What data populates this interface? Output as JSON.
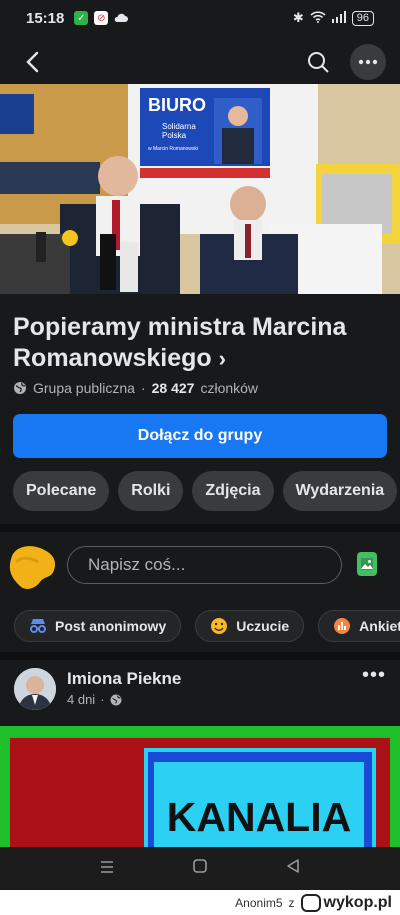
{
  "status_bar": {
    "time": "15:18",
    "battery": "96"
  },
  "nav": {},
  "cover": {
    "sign_title": "BIURO",
    "sign_sub1": "Solidarna",
    "sign_sub2": "Polska",
    "sign_sub3": "w Marcin Romanowski"
  },
  "group": {
    "title": "Popieramy ministra Marcina Romanowskiego",
    "chevron": "›",
    "privacy": "Grupa publiczna",
    "separator": "·",
    "members_count": "28 427",
    "members_label": "członków",
    "join_label": "Dołącz do grupy"
  },
  "tabs": [
    {
      "label": "Polecane"
    },
    {
      "label": "Rolki"
    },
    {
      "label": "Zdjęcia"
    },
    {
      "label": "Wydarzenia"
    }
  ],
  "composer": {
    "placeholder": "Napisz coś..."
  },
  "chips": [
    {
      "label": "Post anonimowy",
      "icon": "incognito-icon"
    },
    {
      "label": "Uczucie",
      "icon": "smiley-icon"
    },
    {
      "label": "Ankieta",
      "icon": "poll-icon"
    }
  ],
  "post": {
    "author": "Imiona Piekne",
    "time": "4 dni",
    "time_sep": "·",
    "more": "•••",
    "image_text": "KANALIA"
  },
  "footer": {
    "user": "Anonim5",
    "joiner": "z",
    "site": "wykop.pl"
  },
  "colors": {
    "background": "#18191a",
    "primary": "#1877f2",
    "pill": "#3a3b3c",
    "green_photo": "#45bd62"
  }
}
